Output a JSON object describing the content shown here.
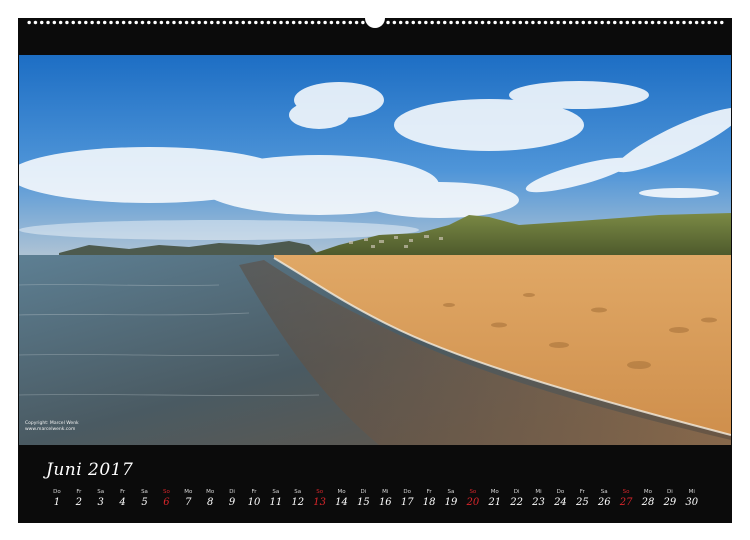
{
  "month_title": "Juni 2017",
  "credit": {
    "line1": "Copyright: Marcel Wenk",
    "line2": "www.marcelwenk.com"
  },
  "days": [
    {
      "wd": "Do",
      "n": "1",
      "sunday": false
    },
    {
      "wd": "Fr",
      "n": "2",
      "sunday": false
    },
    {
      "wd": "Sa",
      "n": "3",
      "sunday": false
    },
    {
      "wd": "Fr",
      "n": "4",
      "sunday": false
    },
    {
      "wd": "Sa",
      "n": "5",
      "sunday": false
    },
    {
      "wd": "So",
      "n": "6",
      "sunday": true
    },
    {
      "wd": "Mo",
      "n": "7",
      "sunday": false
    },
    {
      "wd": "Mo",
      "n": "8",
      "sunday": false
    },
    {
      "wd": "Di",
      "n": "9",
      "sunday": false
    },
    {
      "wd": "Fr",
      "n": "10",
      "sunday": false
    },
    {
      "wd": "Sa",
      "n": "11",
      "sunday": false
    },
    {
      "wd": "Sa",
      "n": "12",
      "sunday": false
    },
    {
      "wd": "So",
      "n": "13",
      "sunday": true
    },
    {
      "wd": "Mo",
      "n": "14",
      "sunday": false
    },
    {
      "wd": "Di",
      "n": "15",
      "sunday": false
    },
    {
      "wd": "Mi",
      "n": "16",
      "sunday": false
    },
    {
      "wd": "Do",
      "n": "17",
      "sunday": false
    },
    {
      "wd": "Fr",
      "n": "18",
      "sunday": false
    },
    {
      "wd": "Sa",
      "n": "19",
      "sunday": false
    },
    {
      "wd": "So",
      "n": "20",
      "sunday": true
    },
    {
      "wd": "Mo",
      "n": "21",
      "sunday": false
    },
    {
      "wd": "Di",
      "n": "22",
      "sunday": false
    },
    {
      "wd": "Mi",
      "n": "23",
      "sunday": false
    },
    {
      "wd": "Do",
      "n": "24",
      "sunday": false
    },
    {
      "wd": "Fr",
      "n": "25",
      "sunday": false
    },
    {
      "wd": "Sa",
      "n": "26",
      "sunday": false
    },
    {
      "wd": "So",
      "n": "27",
      "sunday": true
    },
    {
      "wd": "Mo",
      "n": "28",
      "sunday": false
    },
    {
      "wd": "Di",
      "n": "29",
      "sunday": false
    },
    {
      "wd": "Mi",
      "n": "30",
      "sunday": false
    }
  ],
  "colors": {
    "frame": "#0b0b0b",
    "sunday_red": "#d8262b",
    "text": "#ffffff"
  }
}
